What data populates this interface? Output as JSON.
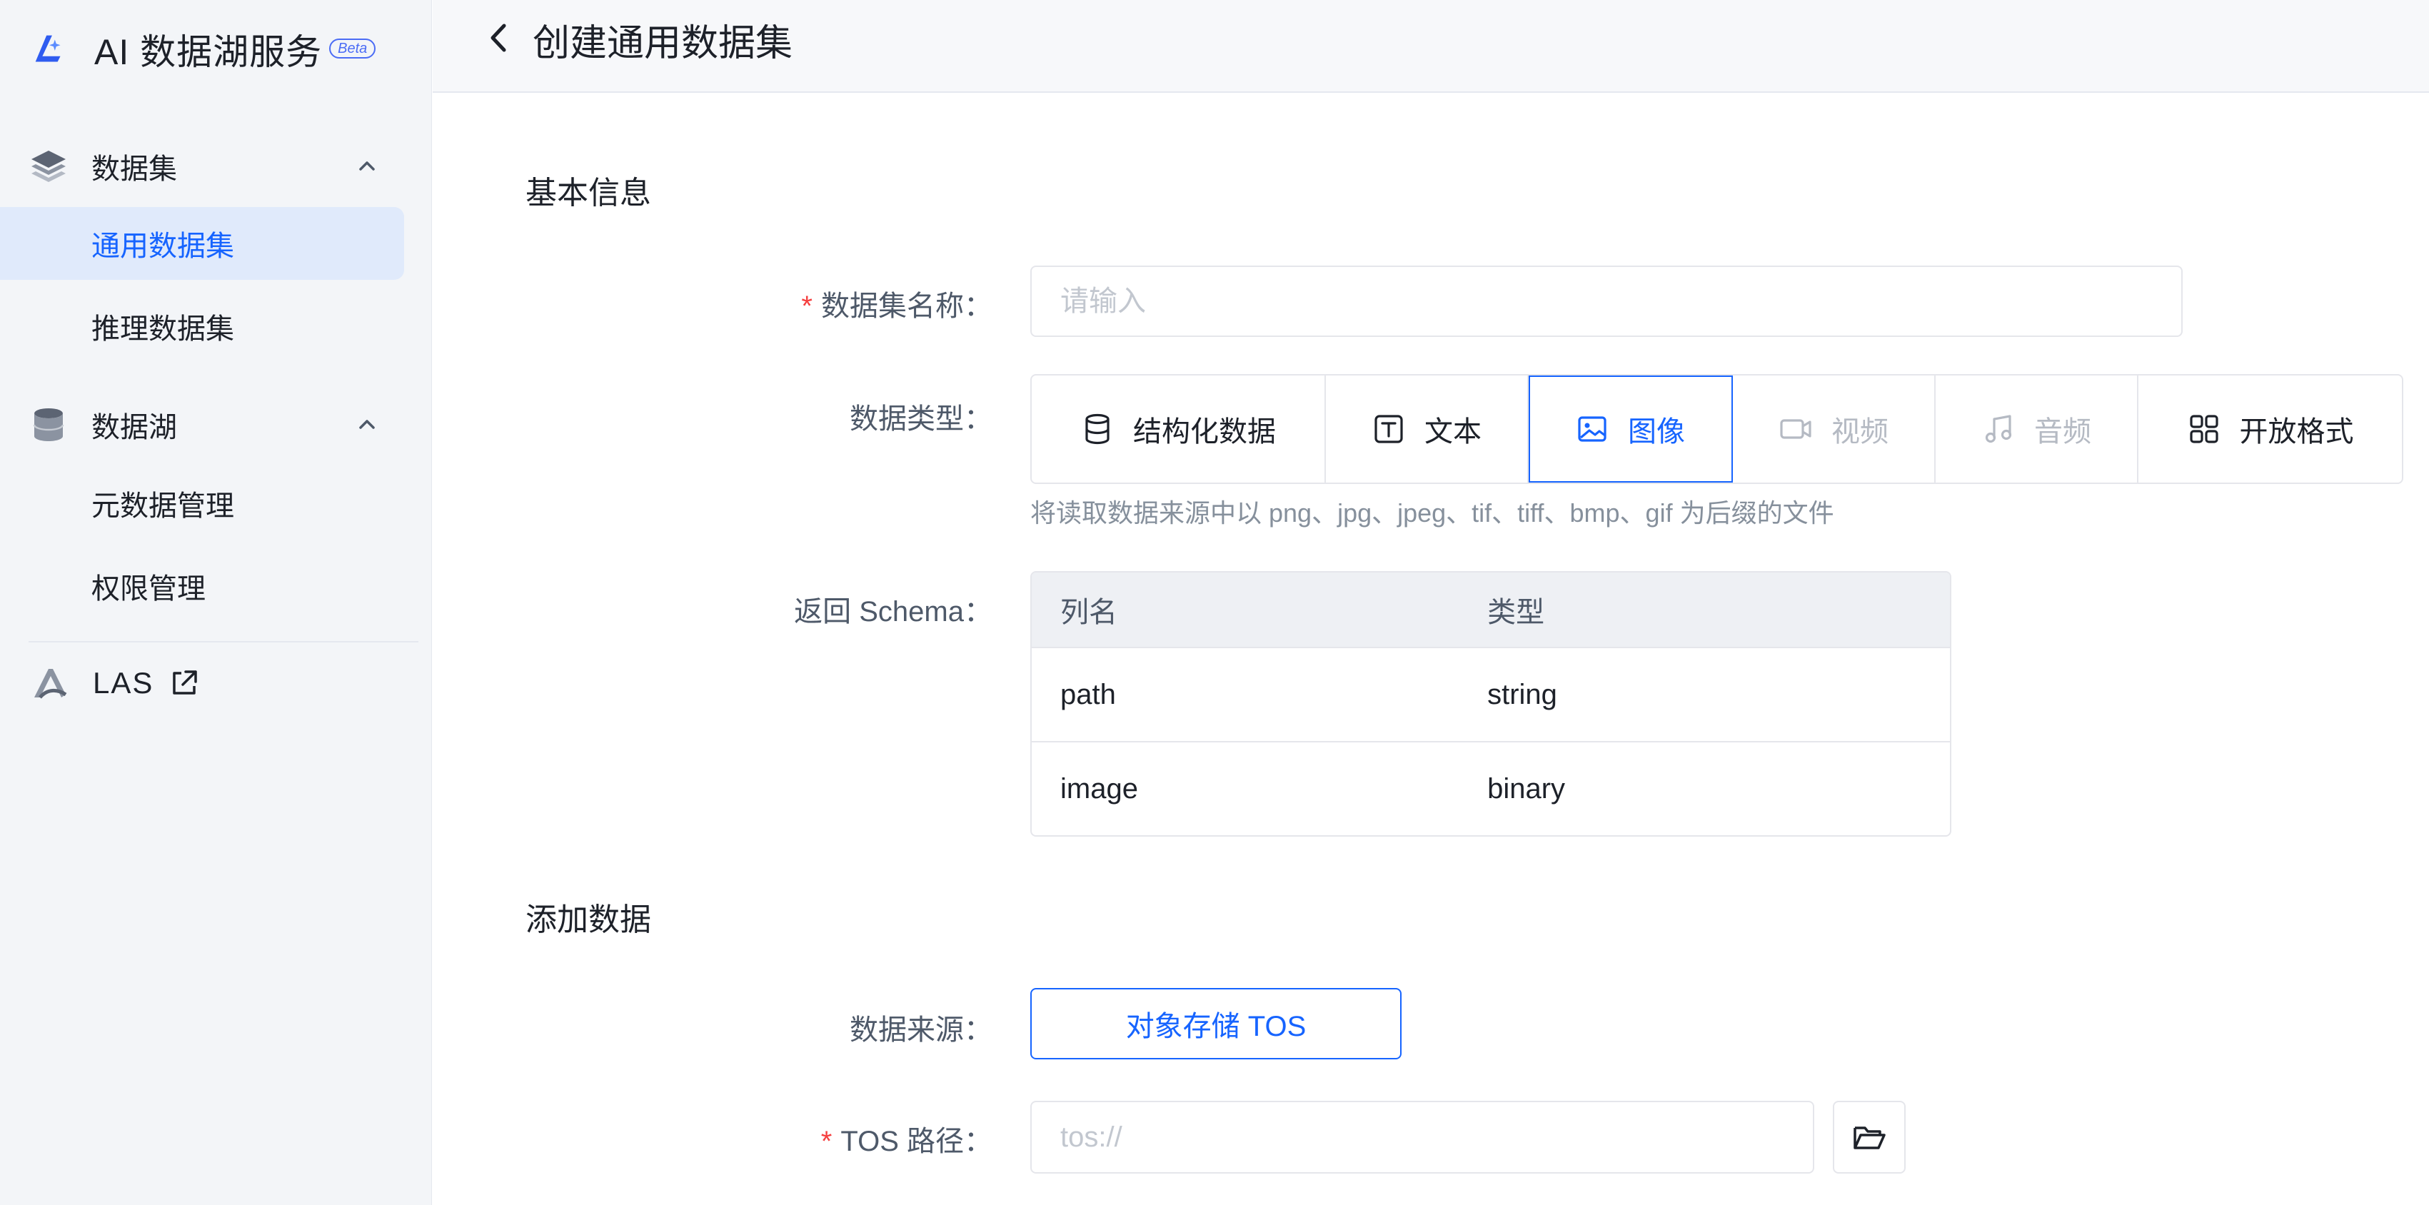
{
  "brand": {
    "title": "AI 数据湖服务",
    "badge": "Beta"
  },
  "sidebar": {
    "groups": [
      {
        "label": "数据集",
        "icon": "layers-icon",
        "expanded": true,
        "items": [
          {
            "label": "通用数据集",
            "active": true
          },
          {
            "label": "推理数据集",
            "active": false
          }
        ]
      },
      {
        "label": "数据湖",
        "icon": "database-icon",
        "expanded": true,
        "items": [
          {
            "label": "元数据管理",
            "active": false
          },
          {
            "label": "权限管理",
            "active": false
          }
        ]
      }
    ],
    "external_link": {
      "label": "LAS",
      "icon": "external-link-icon"
    }
  },
  "header": {
    "title": "创建通用数据集"
  },
  "basic_info": {
    "section_title": "基本信息",
    "name_field": {
      "label": "数据集名称：",
      "required": true,
      "value": "",
      "placeholder": "请输入"
    },
    "data_type": {
      "label": "数据类型：",
      "options": [
        {
          "label": "结构化数据",
          "icon": "database-icon",
          "state": "normal"
        },
        {
          "label": "文本",
          "icon": "text-box-icon",
          "state": "normal"
        },
        {
          "label": "图像",
          "icon": "image-icon",
          "state": "selected"
        },
        {
          "label": "视频",
          "icon": "video-icon",
          "state": "disabled"
        },
        {
          "label": "音频",
          "icon": "music-note-icon",
          "state": "disabled"
        },
        {
          "label": "开放格式",
          "icon": "grid-icon",
          "state": "normal"
        }
      ],
      "hint": "将读取数据来源中以 png、jpg、jpeg、tif、tiff、bmp、gif 为后缀的文件"
    },
    "schema": {
      "label": "返回 Schema：",
      "columns": [
        "列名",
        "类型"
      ],
      "rows": [
        [
          "path",
          "string"
        ],
        [
          "image",
          "binary"
        ]
      ]
    }
  },
  "add_data": {
    "section_title": "添加数据",
    "source": {
      "label": "数据来源：",
      "button_label": "对象存储 TOS"
    },
    "tos_path": {
      "label": "TOS 路径：",
      "required": true,
      "value": "",
      "placeholder": "tos://"
    }
  },
  "colors": {
    "accent": "#1664ff",
    "required": "#f53f3f",
    "sidebar_bg": "#f3f5f8",
    "active_bg": "#e0eafb"
  }
}
